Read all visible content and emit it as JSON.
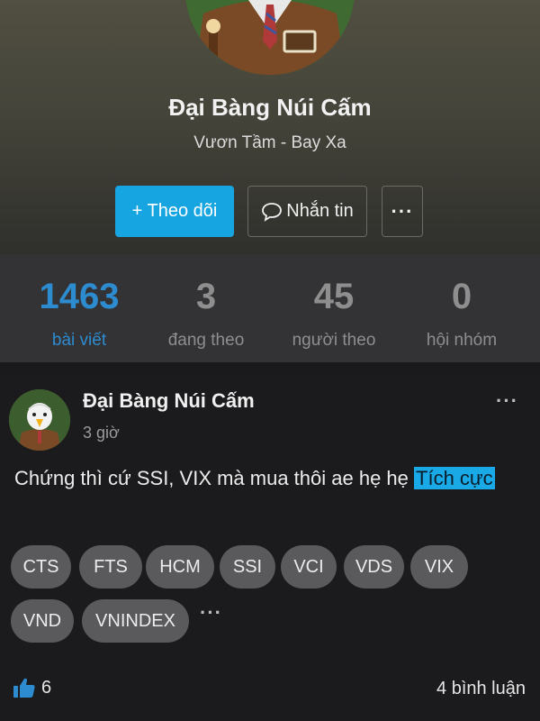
{
  "profile": {
    "name": "Đại Bàng Núi Cấm",
    "tagline": "Vươn Tầm - Bay Xa",
    "follow_label": "+ Theo dõi",
    "message_label": "Nhắn tin",
    "more_label": "···"
  },
  "stats": [
    {
      "value": "1463",
      "label": "bài viết"
    },
    {
      "value": "3",
      "label": "đang theo"
    },
    {
      "value": "45",
      "label": "người theo"
    },
    {
      "value": "0",
      "label": "hội nhóm"
    }
  ],
  "post": {
    "author": "Đại Bàng Núi Cấm",
    "time": "3 giờ",
    "more_label": "···",
    "body_text": "Chứng thì cứ SSI, VIX mà mua thôi ae hẹ hẹ ",
    "sentiment": "Tích cực",
    "tags": [
      "CTS",
      "FTS",
      "HCM",
      "SSI",
      "VCI",
      "VDS",
      "VIX",
      "VND",
      "VNINDEX"
    ],
    "tags_more": "···",
    "likes": "6",
    "comments": "4 bình luận"
  },
  "colors": {
    "accent": "#16a5e1",
    "stat_active": "#2d8bcf"
  }
}
